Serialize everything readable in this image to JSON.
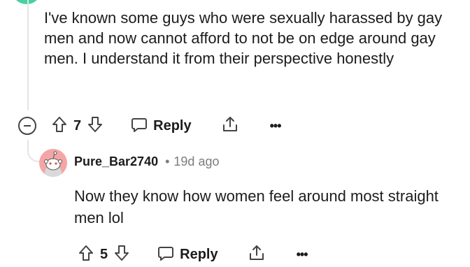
{
  "comment": {
    "body": "I've known some guys who were sexually harassed by gay men and now cannot afford to not be on edge around gay men. I understand it from their perspective honestly",
    "votes": "7",
    "reply_label": "Reply",
    "more_label": "•••",
    "avatar_color": "#46d1a3"
  },
  "reply": {
    "username": "Pure_Bar2740",
    "separator": "•",
    "timestamp": "19d ago",
    "body": "Now they know how women feel around most straight men lol",
    "votes": "5",
    "reply_label": "Reply",
    "more_label": "•••",
    "avatar_color": "#f4a6a6"
  },
  "colors": {
    "text": "#1c1c1c",
    "muted": "#7c7c7c",
    "thread_line": "#e5e5e5"
  },
  "icons": [
    "collapse-icon",
    "upvote-icon",
    "downvote-icon",
    "reply-bubble-icon",
    "share-icon",
    "more-icon"
  ]
}
